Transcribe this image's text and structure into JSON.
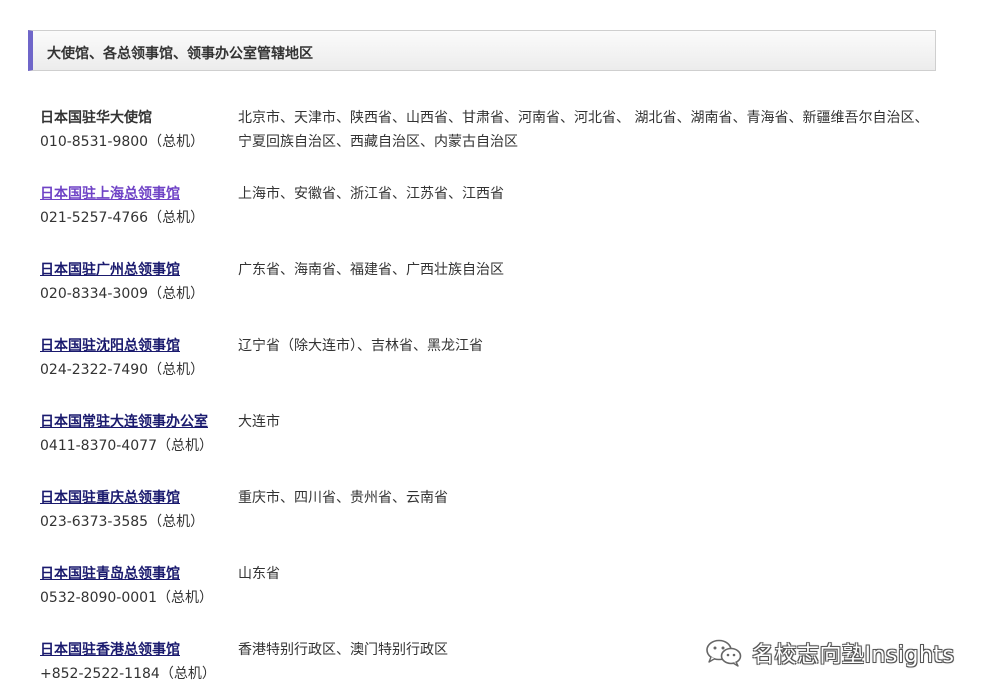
{
  "section": {
    "title": "大使馆、各总领事馆、领事办公室管辖地区"
  },
  "offices": [
    {
      "name": "日本国驻华大使馆",
      "phone": "010-8531-9800（总机）",
      "area": "北京市、天津市、陕西省、山西省、甘肃省、河南省、河北省、 湖北省、湖南省、青海省、新疆维吾尔自治区、宁夏回族自治区、西藏自治区、内蒙古自治区"
    },
    {
      "name": "日本国驻上海总领事馆",
      "phone": "021-5257-4766（总机）",
      "area": "上海市、安徽省、浙江省、江苏省、江西省"
    },
    {
      "name": "日本国驻广州总领事馆",
      "phone": "020-8334-3009（总机）",
      "area": "广东省、海南省、福建省、广西壮族自治区"
    },
    {
      "name": "日本国驻沈阳总领事馆",
      "phone": "024-2322-7490（总机）",
      "area": "辽宁省（除大连市）、吉林省、黑龙江省"
    },
    {
      "name": "日本国常驻大连领事办公室",
      "phone": "0411-8370-4077（总机）",
      "area": "大连市"
    },
    {
      "name": "日本国驻重庆总领事馆",
      "phone": "023-6373-3585（总机）",
      "area": "重庆市、四川省、贵州省、云南省"
    },
    {
      "name": "日本国驻青岛总领事馆",
      "phone": "0532-8090-0001（总机）",
      "area": "山东省"
    },
    {
      "name": "日本国驻香港总领事馆",
      "phone": "+852-2522-1184（总机）",
      "area": "香港特别行政区、澳门特别行政区"
    }
  ],
  "watermark": {
    "text": "名校志向塾Insights",
    "icon": "wechat-icon"
  },
  "colors": {
    "header_accent": "#6f66c9",
    "link": "#1a1a6e",
    "visited_link": "#6f43c6",
    "text": "#333333"
  }
}
